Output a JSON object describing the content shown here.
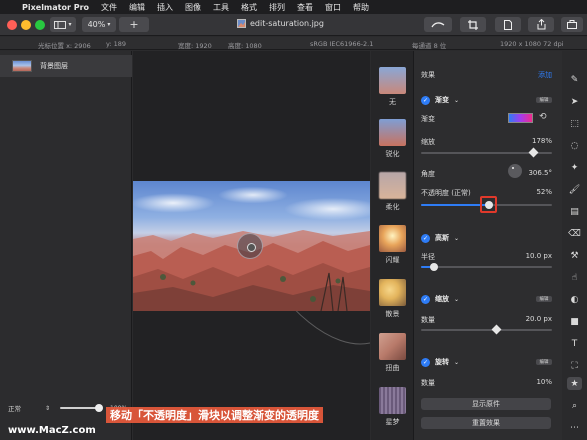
{
  "menubar": {
    "apple": "",
    "app_name": "Pixelmator Pro",
    "items": [
      "文件",
      "编辑",
      "插入",
      "图像",
      "工具",
      "格式",
      "排列",
      "查看",
      "窗口",
      "帮助"
    ]
  },
  "toolbar": {
    "zoom": "40%",
    "add_label": "+",
    "doc_title": "edit-saturation.jpg"
  },
  "infobar": {
    "cursor_label": "光标位置 x: 2906",
    "cursor_y": "y: 189",
    "width": "宽度: 1920",
    "height": "高度: 1080",
    "profile": "sRGB IEC61966-2.1",
    "bits": "每通道 8 位",
    "size": "1920 x 1080 72 dpi"
  },
  "layers": {
    "items": [
      {
        "name": "背景图层"
      }
    ],
    "blend_mode": "正常",
    "opacity": "100%"
  },
  "thumbs": [
    {
      "label": "无",
      "color": "#8aa7d6"
    },
    {
      "label": "锐化",
      "color": "#c88a6e"
    },
    {
      "label": "柔化",
      "color": "#d9b49a"
    },
    {
      "label": "闪耀",
      "color": "#e8a45a"
    },
    {
      "label": "散景",
      "color": "#e3b45c"
    },
    {
      "label": "扭曲",
      "color": "#b87a6a"
    },
    {
      "label": "星梦",
      "color": "#7a6a8a"
    }
  ],
  "effects": {
    "header_label": "效果",
    "add_label": "添加",
    "gradient": {
      "title": "渐变",
      "edit": "编辑",
      "gradient_label": "渐变",
      "scale_label": "缩放",
      "scale_value": "178%",
      "scale_fraction": 0.86,
      "angle_label": "角度",
      "angle_value": "306.5°",
      "opacity_label": "不透明度 (正常)",
      "opacity_value": "52%",
      "opacity_fraction": 0.52
    },
    "blur": {
      "title": "高斯",
      "radius_label": "半径",
      "radius_value": "10.0 px",
      "radius_fraction": 0.1
    },
    "zoom": {
      "title": "缩放",
      "edit": "编辑",
      "amount_label": "数量",
      "amount_value": "20.0 px",
      "amount_fraction": 0.58
    },
    "twirl": {
      "title": "旋转",
      "edit": "编辑",
      "amount_label": "数量",
      "amount_value": "10%"
    },
    "show_original": "显示原件",
    "reset_effects": "重置效果"
  },
  "overlay": {
    "caption": "移动「不透明度」滑块以调整渐变的透明度",
    "watermark": "www.MacZ.com"
  },
  "colors": {
    "accent": "#2e7cf6",
    "highlight_box": "#e0392b",
    "caption_bg": "#e85a3c"
  }
}
